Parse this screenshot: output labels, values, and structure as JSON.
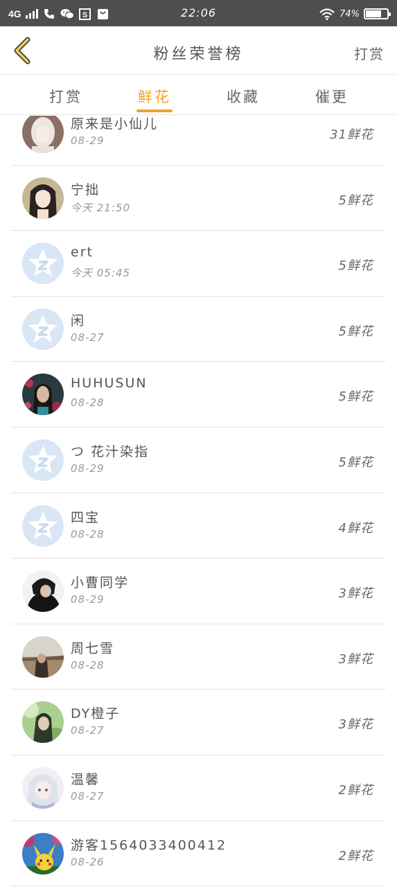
{
  "status_bar": {
    "network": "4G",
    "time": "22:06",
    "battery_text": "74%",
    "battery_level": 0.74,
    "icons": [
      "signal-icon",
      "phone-icon",
      "wechat-icon",
      "s-app-icon",
      "bag-app-icon",
      "wifi-icon",
      "battery-icon"
    ]
  },
  "header": {
    "title": "粉丝荣誉榜",
    "back_icon": "chevron-left-icon",
    "right_button": "打赏"
  },
  "tabs": [
    {
      "label": "打赏",
      "active": false
    },
    {
      "label": "鲜花",
      "active": true
    },
    {
      "label": "收藏",
      "active": false
    },
    {
      "label": "催更",
      "active": false
    }
  ],
  "colors": {
    "accent": "#f1a12a",
    "status_bar": "#4e4e4e",
    "default_avatar": "#d8e6f5"
  },
  "list": [
    {
      "name": "原来是小仙儿",
      "date": "08-29",
      "flowers": "31鲜花",
      "avatar": "photo-girl-light"
    },
    {
      "name": "宁拙",
      "date": "今天 21:50",
      "flowers": "5鲜花",
      "avatar": "illustration-girl"
    },
    {
      "name": "ert",
      "date": "今天 05:45",
      "flowers": "5鲜花",
      "avatar": "default"
    },
    {
      "name": "闲",
      "date": "08-27",
      "flowers": "5鲜花",
      "avatar": "default"
    },
    {
      "name": "HUHUSUN",
      "date": "08-28",
      "flowers": "5鲜花",
      "avatar": "photo-woman-dark"
    },
    {
      "name": "つ 花汁染指",
      "date": "08-29",
      "flowers": "5鲜花",
      "avatar": "default"
    },
    {
      "name": "四宝",
      "date": "08-28",
      "flowers": "4鲜花",
      "avatar": "default"
    },
    {
      "name": "小曹同学",
      "date": "08-29",
      "flowers": "3鲜花",
      "avatar": "photo-man-dark"
    },
    {
      "name": "周七雪",
      "date": "08-28",
      "flowers": "3鲜花",
      "avatar": "photo-field"
    },
    {
      "name": "DY橙子",
      "date": "08-27",
      "flowers": "3鲜花",
      "avatar": "photo-green"
    },
    {
      "name": "温馨",
      "date": "08-27",
      "flowers": "2鲜花",
      "avatar": "illustration-white-hair"
    },
    {
      "name": "游客1564033400412",
      "date": "08-26",
      "flowers": "2鲜花",
      "avatar": "pikachu"
    }
  ]
}
